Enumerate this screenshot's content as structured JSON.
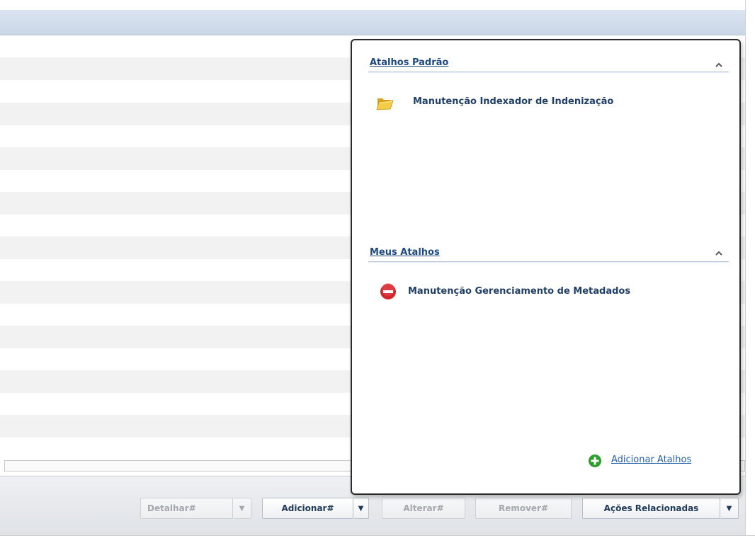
{
  "popup": {
    "sections": [
      {
        "title": "Atalhos Padrão",
        "items": [
          {
            "label": "Manutenção Indexador de Indenização",
            "icon": "folder-icon"
          }
        ]
      },
      {
        "title": "Meus Atalhos",
        "items": [
          {
            "label": "Manutenção Gerenciamento de Metadados",
            "icon": "remove-icon"
          }
        ]
      }
    ],
    "add_shortcut": {
      "label": "Adicionar Atalhos",
      "icon": "add-icon"
    }
  },
  "toolbar": {
    "buttons": [
      {
        "label": "Detalhar#",
        "enabled": false
      },
      {
        "label": "Adicionar#",
        "enabled": true
      },
      {
        "label": "Alterar#",
        "enabled": false
      },
      {
        "label": "Remover#",
        "enabled": false
      },
      {
        "label": "Ações Relacionadas",
        "enabled": true
      }
    ]
  },
  "colors": {
    "link": "#1e4a80",
    "remove_icon": "#d2262b",
    "add_icon": "#2e9c2e",
    "folder_icon": "#f2c436"
  }
}
